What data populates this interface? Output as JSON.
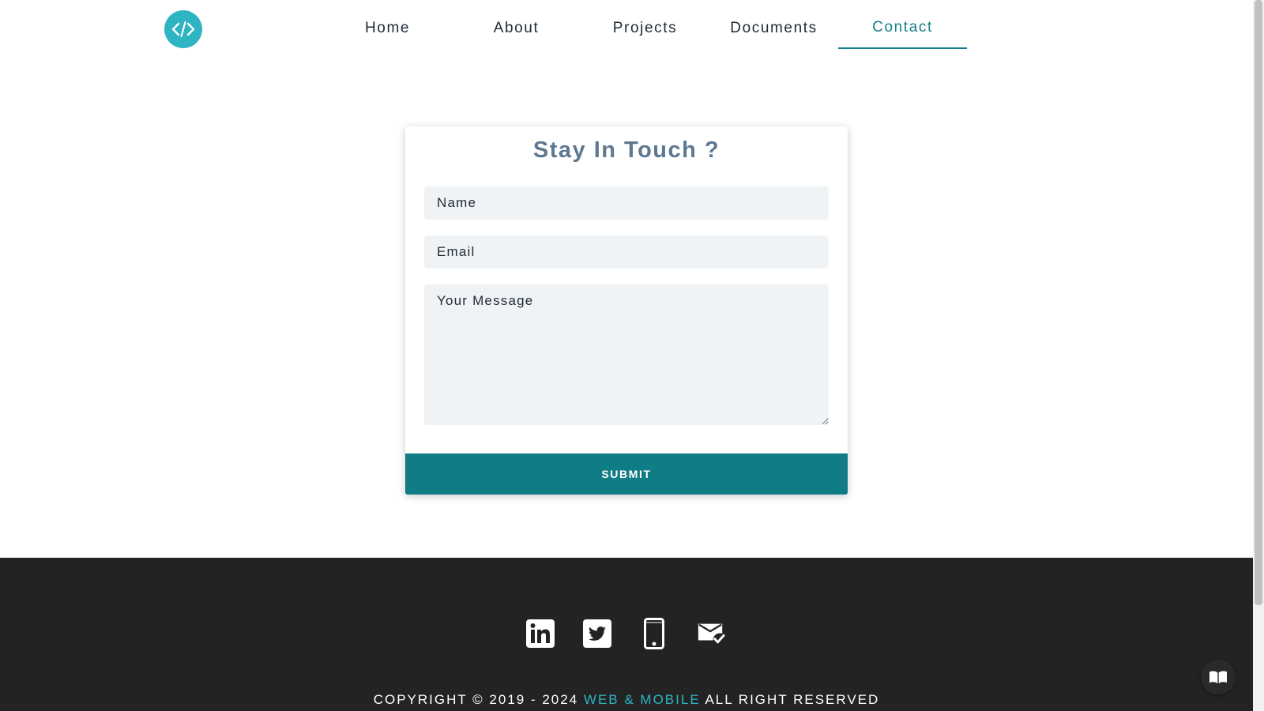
{
  "header": {
    "logo_icon": "code-icon",
    "nav": [
      {
        "label": "Home",
        "active": false
      },
      {
        "label": "About",
        "active": false
      },
      {
        "label": "Projects",
        "active": false
      },
      {
        "label": "Documents",
        "active": false
      },
      {
        "label": "Contact",
        "active": true
      }
    ]
  },
  "contact_form": {
    "title": "Stay In Touch ?",
    "name_placeholder": "Name",
    "email_placeholder": "Email",
    "message_placeholder": "Your Message",
    "submit_label": "SUBMIT"
  },
  "footer": {
    "social_icons": [
      "linkedin-icon",
      "twitter-icon",
      "phone-icon",
      "mail-check-icon"
    ],
    "copyright_prefix": "COPYRIGHT © 2019 - 2024",
    "copyright_brand": "WEB & MOBILE",
    "copyright_suffix": "ALL RIGHT RESERVED"
  },
  "colors": {
    "accent": "#2fb4c2",
    "primary": "#107c86",
    "title": "#5d7891",
    "footer_bg": "#232323"
  }
}
